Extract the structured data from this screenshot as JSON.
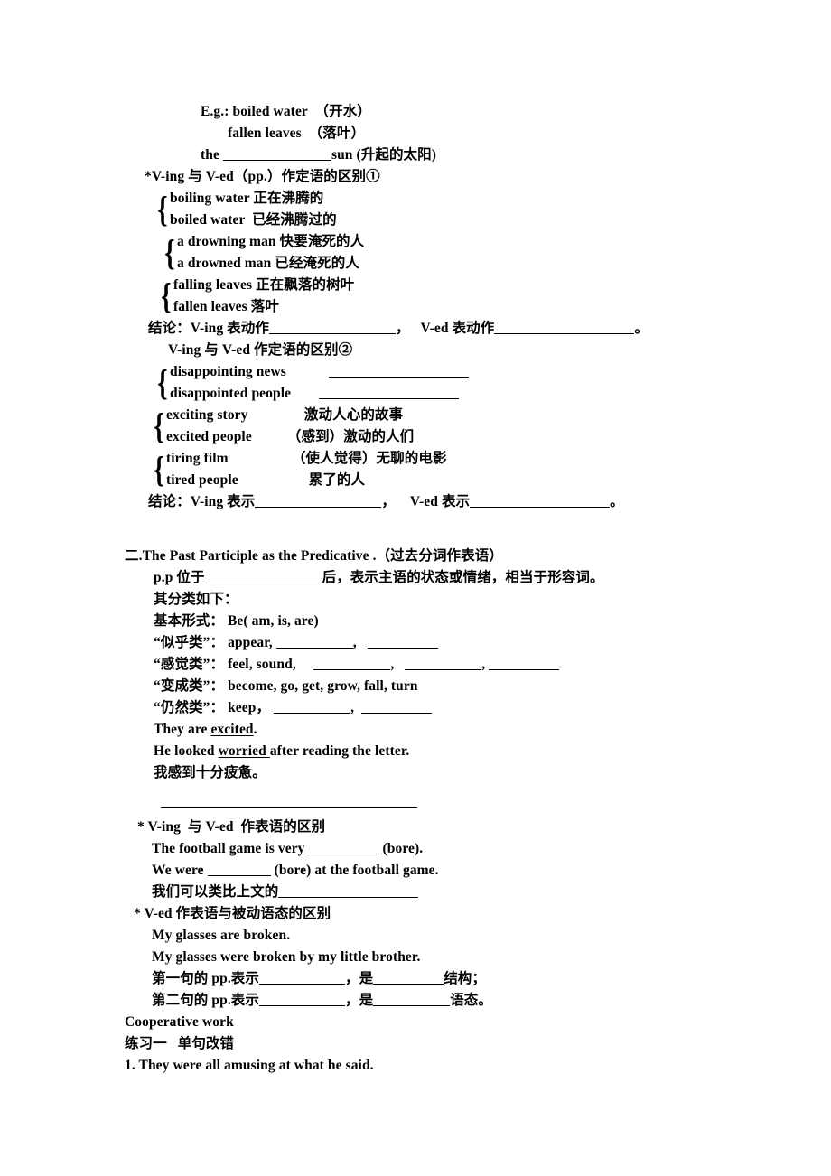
{
  "document": {
    "title": "The Past Participle grammar worksheet",
    "examples_intro": {
      "eg_label": "E.g.:",
      "items": [
        {
          "en": "boiled water",
          "zh": "（开水）"
        },
        {
          "en": "fallen leaves",
          "zh": "（落叶）"
        },
        {
          "en_before": "the ",
          "blank": true,
          "en_after": "sun",
          "zh": "(升起的太阳)"
        }
      ]
    },
    "section_one": {
      "heading_1": "*V-ing 与 V-ed（pp.）作定语的区别①",
      "brace_groups_1": [
        {
          "rows": [
            {
              "en": "boiling water",
              "zh": "正在沸腾的"
            },
            {
              "en": "boiled water",
              "zh": " 已经沸腾过的"
            }
          ]
        },
        {
          "rows": [
            {
              "en": "a drowning man",
              "zh": "快要淹死的人"
            },
            {
              "en": "a drowned man",
              "zh": "已经淹死的人"
            }
          ]
        },
        {
          "rows": [
            {
              "en": "falling leaves",
              "zh": "正在飘落的树叶"
            },
            {
              "en": "fallen leaves",
              "zh": "落叶"
            }
          ]
        }
      ],
      "conclusion_1": {
        "prefix": "结论：V-ing 表动作",
        "middle": "，   V-ed 表动作",
        "suffix": "。"
      },
      "heading_2": "V-ing 与 V-ed 作定语的区别②",
      "brace_groups_2": [
        {
          "rows": [
            {
              "en": "disappointing news",
              "zh": "",
              "blank": true
            },
            {
              "en": "disappointed people",
              "zh": "",
              "blank": true
            }
          ]
        },
        {
          "rows": [
            {
              "en": "exciting story",
              "zh": "激动人心的故事"
            },
            {
              "en": "excited people",
              "zh": "（感到）激动的人们"
            }
          ]
        },
        {
          "rows": [
            {
              "en": "tiring film",
              "zh": "（使人觉得）无聊的电影"
            },
            {
              "en": "tired people",
              "zh": "累了的人"
            }
          ]
        }
      ],
      "conclusion_2": {
        "prefix": "结论：V-ing 表示",
        "middle": "，    V-ed 表示",
        "suffix": "。"
      }
    },
    "section_two": {
      "heading": "二.The Past Participle as the Predicative .（过去分词作表语）",
      "rule_line": {
        "prefix": "p.p 位于",
        "suffix": "后，表示主语的状态或情绪，相当于形容词。"
      },
      "classification_label": "其分类如下：",
      "categories": [
        {
          "label": "基本形式：",
          "content": " Be( am, is, are)",
          "blanks": 0
        },
        {
          "label": "“似乎类”：",
          "content": " appear,",
          "blanks": 2
        },
        {
          "label": "“感觉类”：",
          "content": " feel, sound,",
          "blanks": 3
        },
        {
          "label": "“变成类”：",
          "content": " become, go, get, grow, fall, turn",
          "blanks": 0
        },
        {
          "label": "“仍然类”：",
          "content": " keep，",
          "blanks": 2
        }
      ],
      "example_sentences": [
        {
          "before": "They are ",
          "underlined": "excited",
          "after": "."
        },
        {
          "before": "He looked ",
          "underlined": "worried ",
          "after": "after reading the letter."
        }
      ],
      "chinese_prompt": "我感到十分疲惫。",
      "comparison_ving": {
        "heading": "* V-ing  与 V-ed  作表语的区别",
        "lines": [
          {
            "before": "The football game is very ",
            "after": " (bore)."
          },
          {
            "before": "We were ",
            "after": " (bore) at the football game."
          }
        ],
        "analogy": "我们可以类比上文的"
      },
      "comparison_ved": {
        "heading": "* V-ed 作表语与被动语态的区别",
        "sentences": [
          "My glasses are broken.",
          "My glasses were broken by my little brother."
        ],
        "fill_lines": [
          {
            "a": "第一句的 pp.表示",
            "b": "，是",
            "c": "结构；"
          },
          {
            "a": "第二句的 pp.表示",
            "b": "，是",
            "c": "语态。"
          }
        ]
      }
    },
    "section_three": {
      "heading": "Cooperative work",
      "exercise_title": "练习一   单句改错",
      "items": [
        "1. They were all amusing at what he said."
      ]
    }
  },
  "colors": {
    "text": "#000000",
    "background": "#ffffff",
    "rule": "#000000"
  }
}
